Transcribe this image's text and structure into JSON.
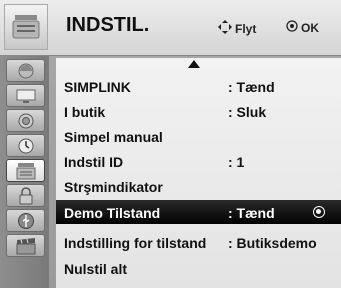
{
  "header": {
    "title": "INDSTIL.",
    "nav_hint": "Flyt",
    "ok_hint": "OK"
  },
  "sidebar": {
    "icons": [
      "picture-icon",
      "screen-icon",
      "sound-icon",
      "time-icon",
      "option-icon",
      "lock-icon",
      "usb-icon",
      "movie-icon"
    ],
    "active": "option-icon"
  },
  "menu": {
    "items": [
      {
        "label": "SIMPLINK",
        "value": ": Tænd"
      },
      {
        "label": "I butik",
        "value": ": Sluk"
      },
      {
        "label": "Simpel manual",
        "value": ""
      },
      {
        "label": "Indstil ID",
        "value": ": 1"
      },
      {
        "label": "Strşmindikator",
        "value": ""
      },
      {
        "label": "Demo Tilstand",
        "value": ": Tænd"
      },
      {
        "label": "Indstilling for tilstand",
        "value": ": Butiksdemo"
      },
      {
        "label": "Nulstil alt",
        "value": ""
      }
    ],
    "selected_index": 5
  }
}
